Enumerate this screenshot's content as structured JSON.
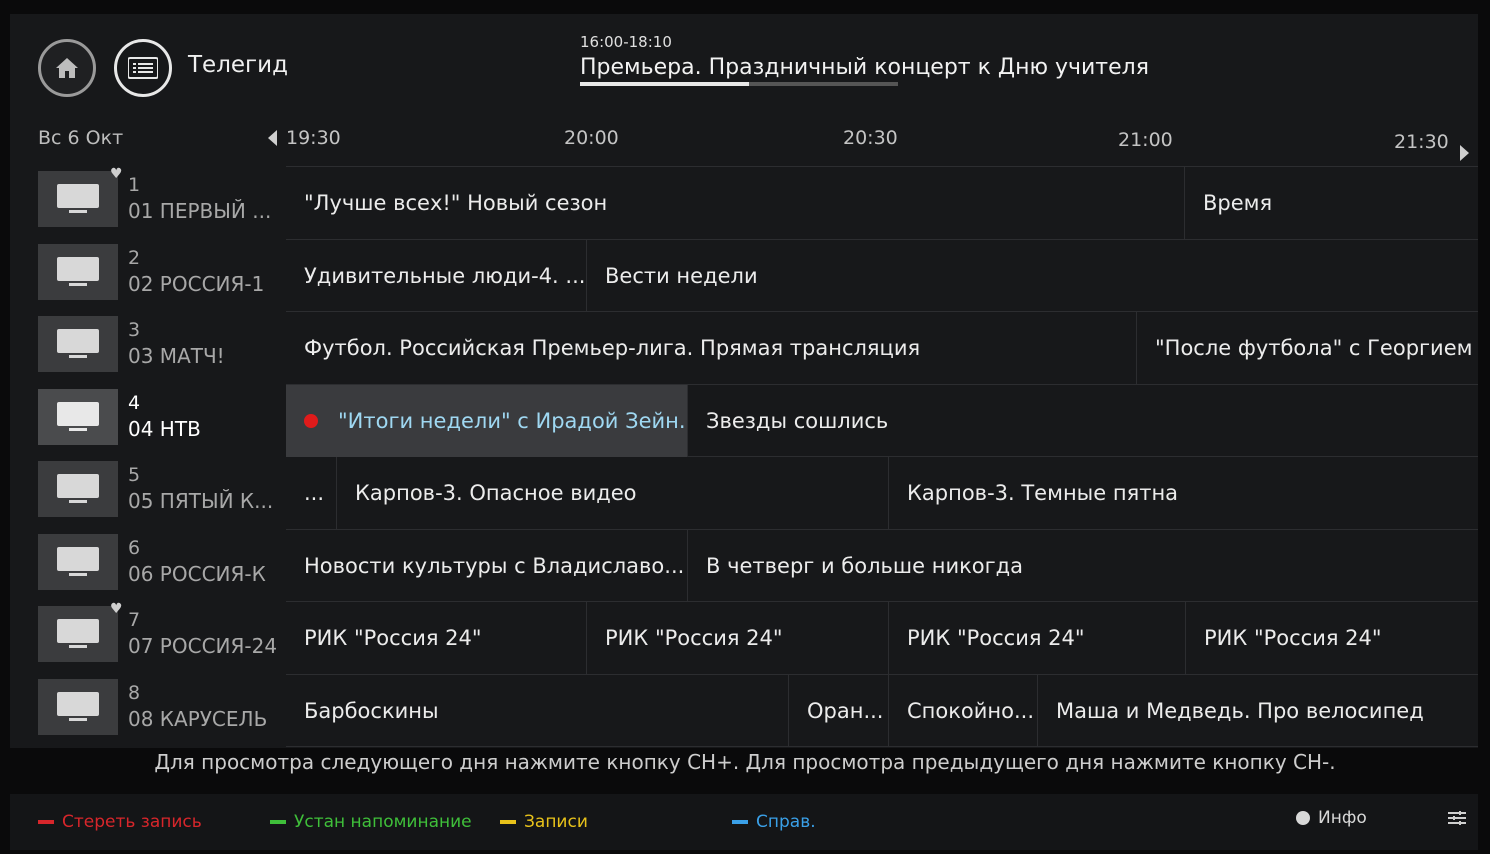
{
  "header": {
    "app_title": "Телегид",
    "now_time": "16:00-18:10",
    "now_title": "Премьера. Праздничный концерт к Дню учителя",
    "now_progress": 0.53
  },
  "timeline": {
    "date": "Вс 6 Окт",
    "times": [
      "19:30",
      "20:00",
      "20:30",
      "21:00",
      "21:30"
    ]
  },
  "channels": [
    {
      "num": "1",
      "name": "01 ПЕРВЫЙ ...",
      "favorite": true
    },
    {
      "num": "2",
      "name": "02 РОССИЯ-1",
      "favorite": false
    },
    {
      "num": "3",
      "name": "03 МАТЧ!",
      "favorite": false
    },
    {
      "num": "4",
      "name": "04 НТВ",
      "favorite": false,
      "active": true
    },
    {
      "num": "5",
      "name": "05 ПЯТЫЙ К...",
      "favorite": false
    },
    {
      "num": "6",
      "name": "06 РОССИЯ-К",
      "favorite": false
    },
    {
      "num": "7",
      "name": "07 РОССИЯ-24",
      "favorite": true
    },
    {
      "num": "8",
      "name": "08 КАРУСЕЛЬ",
      "favorite": false
    }
  ],
  "programs": [
    [
      "\"Лучше всех!\" Новый сезон",
      "Время"
    ],
    [
      "Удивительные люди-4. ...",
      "Вести недели"
    ],
    [
      "Футбол. Российская Премьер-лига. Прямая трансляция",
      "\"После футбола\" с Георгием ..."
    ],
    [
      "\"Итоги недели\" с Ирадой Зейн...",
      "Звезды сошлись"
    ],
    [
      "...",
      "Карпов-3. Опасное видео",
      "Карпов-3. Темные пятна"
    ],
    [
      "Новости культуры с Владиславо...",
      "В четверг и больше никогда"
    ],
    [
      "РИК \"Россия 24\"",
      "РИК \"Россия 24\"",
      "РИК \"Россия 24\"",
      "РИК \"Россия 24\""
    ],
    [
      "Барбоскины",
      "Оран...",
      "Спокойно...",
      "Маша и Медведь. Про велосипед"
    ]
  ],
  "hint": "Для просмотра следующего дня нажмите кнопку CH+. Для просмотра предыдущего дня нажмите кнопку CH-.",
  "footer": {
    "red": "Стереть запись",
    "green": "Устан напоминание",
    "yellow": "Записи",
    "blue": "Справ.",
    "info": "Инфо"
  },
  "colors": {
    "red": "#d8262b",
    "green": "#3fbf3a",
    "yellow": "#e8c21a",
    "blue": "#3aa0e8",
    "focus_text": "#9fd8f2"
  }
}
